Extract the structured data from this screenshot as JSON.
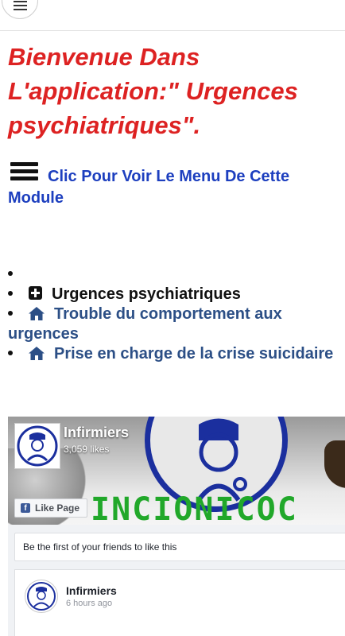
{
  "topbar": {
    "menu_icon": "hamburger-menu-icon"
  },
  "welcome": {
    "title": "Bienvenue Dans L'application:\" Urgences psychiatriques\"."
  },
  "menu_link": {
    "icon": "hamburger-menu-icon",
    "label": "Clic Pour Voir Le Menu De Cette Module"
  },
  "nav": {
    "items": [
      {
        "label": "",
        "icon": ""
      },
      {
        "label": "Urgences psychiatriques",
        "icon": "plus-square-icon"
      },
      {
        "label": "Trouble du comportement aux urgences",
        "icon": "home-icon"
      },
      {
        "label": "Prise en charge de la crise suicidaire",
        "icon": "home-icon"
      }
    ]
  },
  "facebook": {
    "page_name": "Infirmiers",
    "likes": "3,059 likes",
    "like_button": "Like Page",
    "friends_prompt": "Be the first of your friends to like this",
    "post": {
      "author": "Infirmiers",
      "time": "6 hours ago"
    },
    "colors": {
      "brand_green": "#21a82a",
      "ring_blue": "#1b2f9e",
      "fb_blue": "#3b5998"
    }
  },
  "colors": {
    "welcome_red": "#dd2222",
    "link_blue": "#1d3fbf",
    "nav_blue": "#2c4f86"
  }
}
